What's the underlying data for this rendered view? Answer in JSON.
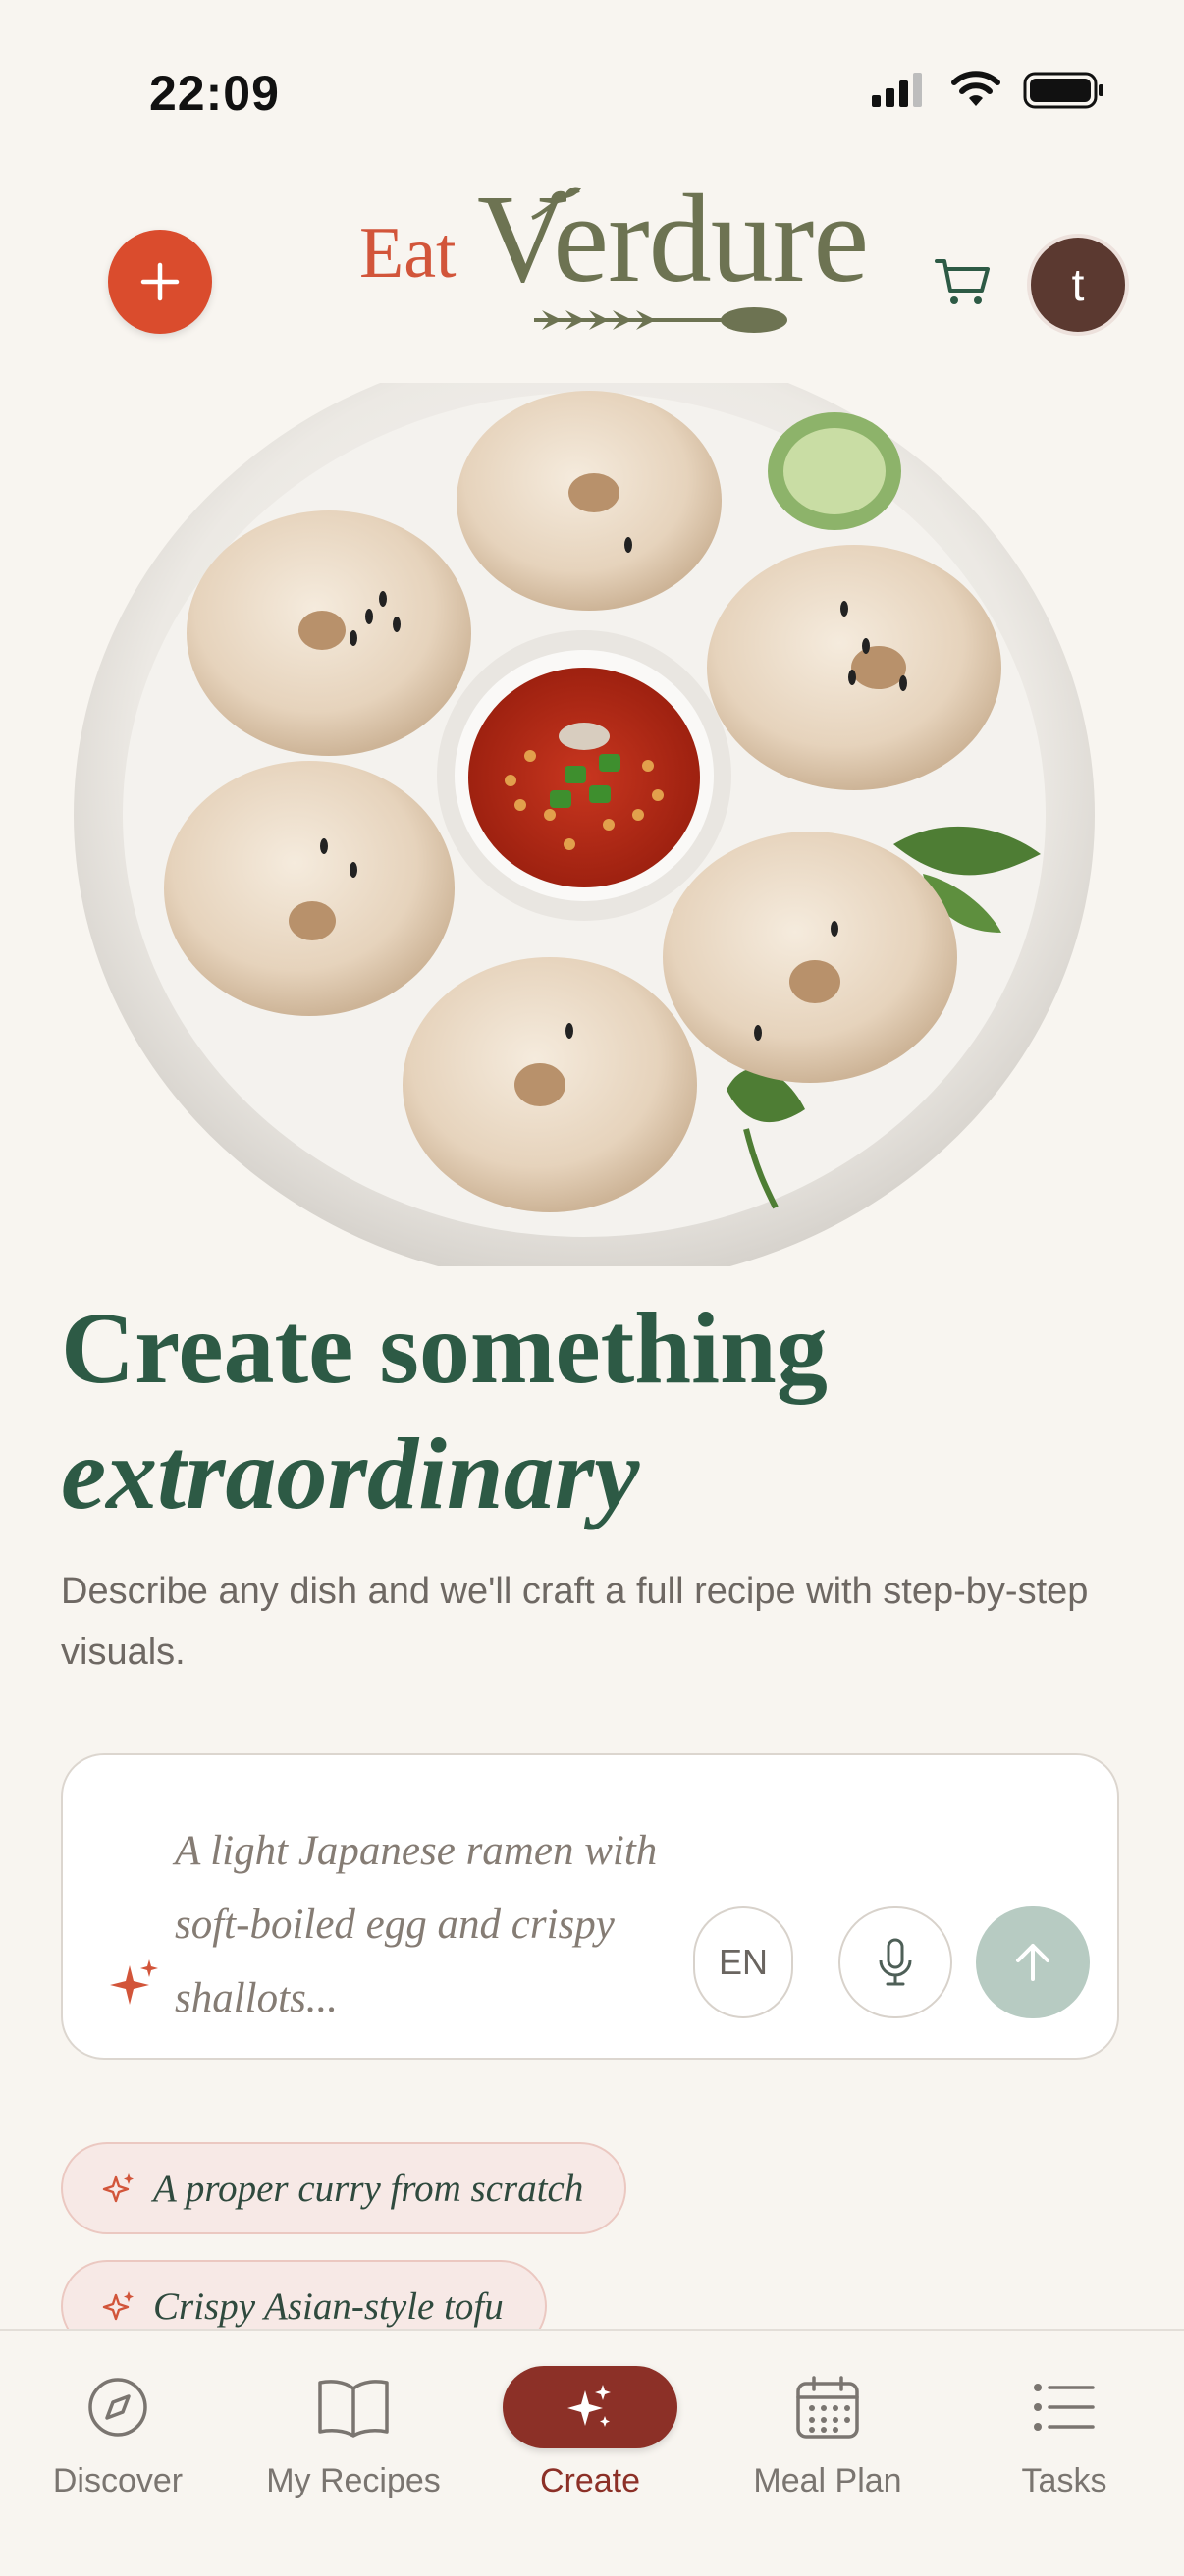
{
  "status_bar": {
    "time": "22:09"
  },
  "header": {
    "logo_eat": "Eat",
    "logo_verdure": "Verdure",
    "avatar_initial": "t"
  },
  "hero": {
    "headline_line1": "Create something",
    "headline_line2": "extraordinary",
    "subtitle": "Describe any dish and we'll craft a full recipe with step-by-step visuals."
  },
  "prompt": {
    "placeholder": "A light Japanese ramen with soft-boiled egg and crispy shallots...",
    "language": "EN"
  },
  "suggestions": [
    {
      "label": "A proper curry from scratch"
    },
    {
      "label": "Crispy Asian-style tofu"
    }
  ],
  "nav": {
    "items": [
      {
        "label": "Discover",
        "icon": "compass-icon"
      },
      {
        "label": "My Recipes",
        "icon": "book-icon"
      },
      {
        "label": "Create",
        "icon": "sparkles-icon",
        "active": true
      },
      {
        "label": "Meal Plan",
        "icon": "calendar-icon"
      },
      {
        "label": "Tasks",
        "icon": "list-icon"
      }
    ]
  },
  "colors": {
    "background": "#F8F5F0",
    "brand_green": "#2D5A45",
    "accent_red": "#DA4C2D",
    "nav_active": "#8C3027",
    "send_button": "#B7CBC2"
  }
}
